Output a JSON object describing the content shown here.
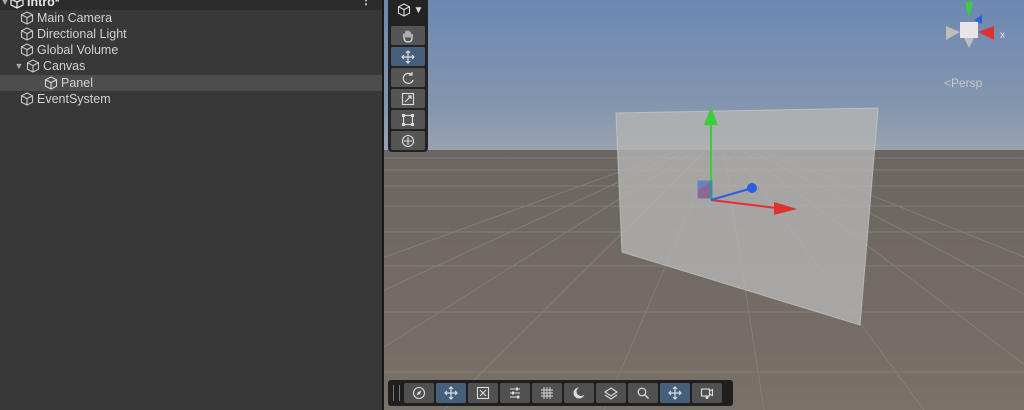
{
  "hierarchy": {
    "scene_name": "Intro*",
    "items": [
      {
        "label": "Main Camera"
      },
      {
        "label": "Directional Light"
      },
      {
        "label": "Global Volume"
      },
      {
        "label": "Canvas"
      },
      {
        "label": "Panel"
      },
      {
        "label": "EventSystem"
      }
    ]
  },
  "scene_view": {
    "projection_label": "<Persp",
    "gizmo_axis_label": "x",
    "tools": [
      "hand-tool",
      "move-tool",
      "rotate-tool",
      "scale-tool",
      "rect-tool",
      "transform-tool"
    ],
    "active_tool": "move-tool",
    "bottom_toolbar": [
      "compass",
      "move",
      "snap",
      "align",
      "grid",
      "shading",
      "layers",
      "zoom",
      "move-active",
      "camera"
    ]
  },
  "colors": {
    "panel_bg": "#383838",
    "selection": "#4d4d4d",
    "active_tool": "#46607c",
    "axis_x": "#e03030",
    "axis_y": "#3ccc3c",
    "axis_z": "#2a5fe0"
  }
}
